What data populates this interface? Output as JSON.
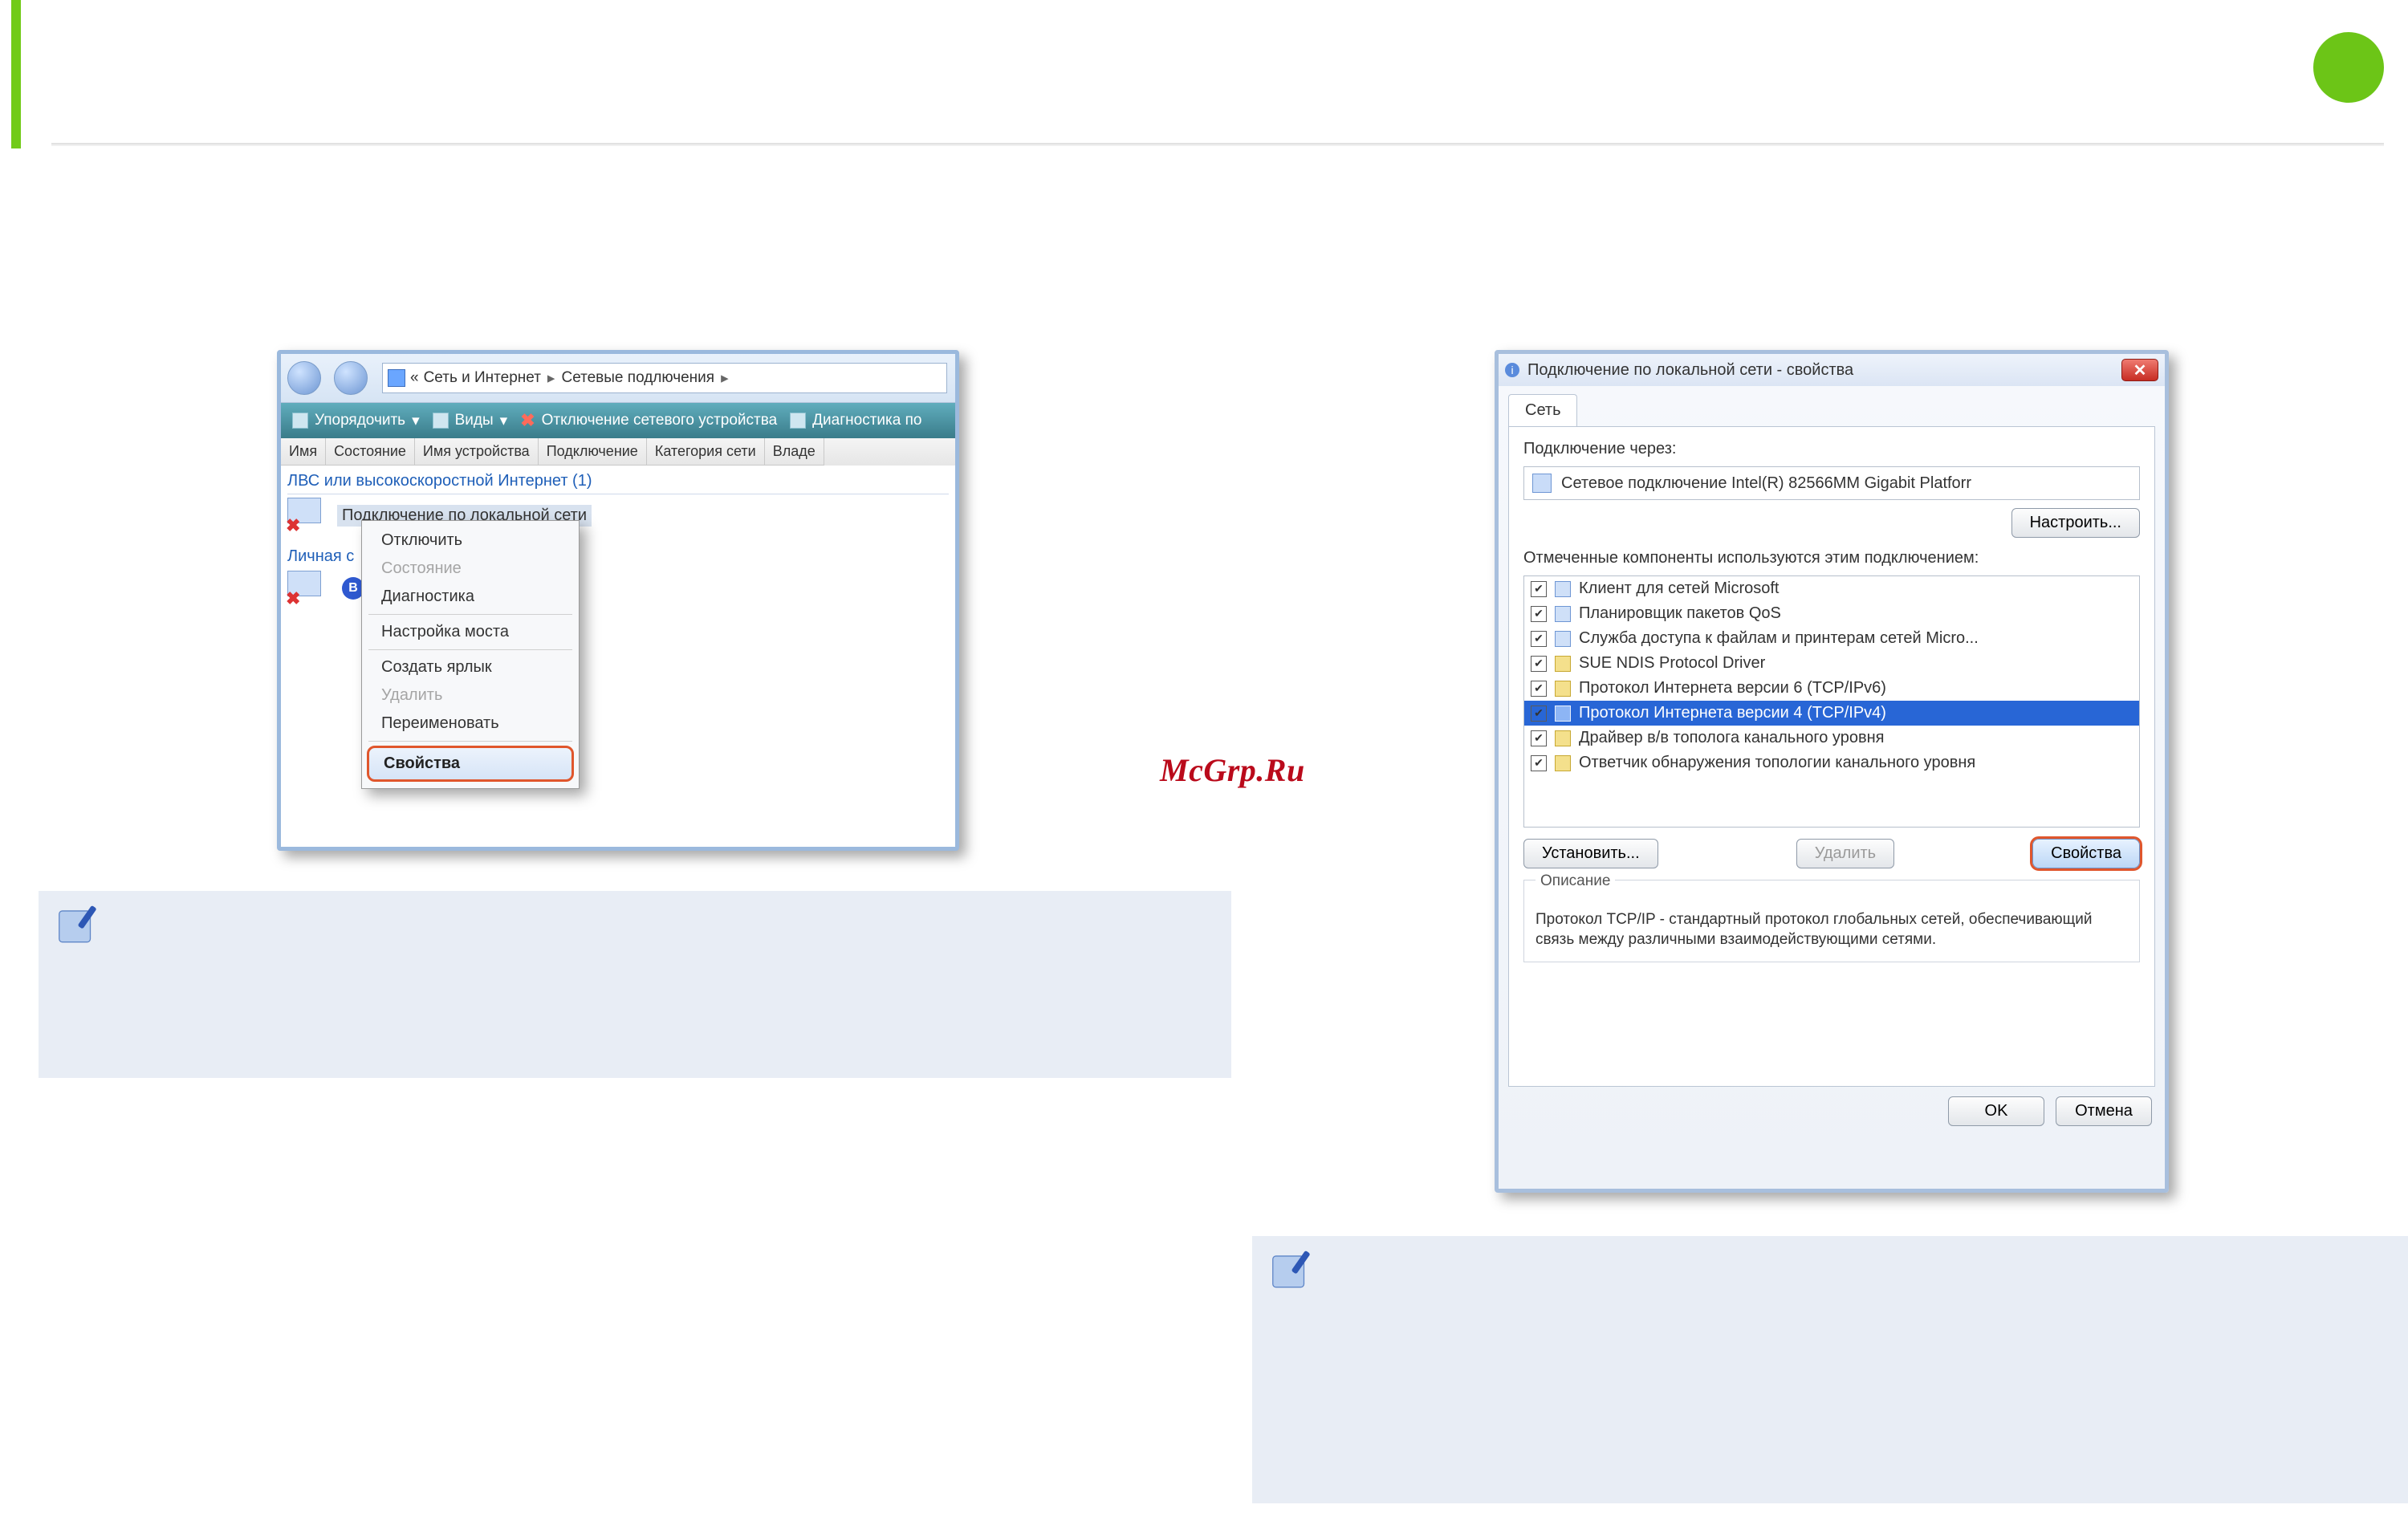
{
  "page": {
    "watermark": "McGrp.Ru"
  },
  "win1": {
    "breadcrumb_glyph": "«",
    "breadcrumb_a": "Сеть и Интернет",
    "breadcrumb_b": "Сетевые подлючения",
    "breadcrumb_sep": "▸",
    "tool_organize": "Упорядочить",
    "tool_views": "Виды",
    "tool_disable": "Отключение сетевого устройства",
    "tool_diag": "Диагностика по",
    "cols": {
      "name": "Имя",
      "status": "Состояние",
      "device": "Имя устройства",
      "connection": "Подключение",
      "category": "Категория сети",
      "owner": "Владе"
    },
    "group": "ЛВС или высокоскоростной Интернет (1)",
    "conn_label": "Подключение по локальной сети",
    "personal": "Личная с",
    "ctx": {
      "disable": "Отключить",
      "status": "Состояние",
      "diag": "Диагностика",
      "bridge": "Настройка моста",
      "shortcut": "Создать ярлык",
      "delete": "Удалить",
      "rename": "Переименовать",
      "properties": "Свойства"
    }
  },
  "win2": {
    "title": "Подключение по локальной сети - свойства",
    "tab": "Сеть",
    "via_label": "Подключение через:",
    "via_value": "Сетевое подключение Intel(R) 82566MM Gigabit Platforr",
    "configure": "Настроить...",
    "comp_label": "Отмеченные компоненты используются этим подключением:",
    "components": [
      "Клиент для сетей Microsoft",
      "Планировщик пакетов QoS",
      "Служба доступа к файлам и принтерам сетей Micro...",
      "SUE NDIS Protocol Driver",
      "Протокол Интернета версии 6 (TCP/IPv6)",
      "Протокол Интернета версии 4 (TCP/IPv4)",
      "Драйвер в/в тополога канального уровня",
      "Ответчик обнаружения топологии канального уровня"
    ],
    "install": "Установить...",
    "delete": "Удалить",
    "properties": "Свойства",
    "desc_title": "Описание",
    "desc_text": "Протокол TCP/IP - стандартный протокол глобальных сетей, обеспечивающий связь между различными взаимодействующими сетями.",
    "ok": "OK",
    "cancel": "Отмена"
  }
}
